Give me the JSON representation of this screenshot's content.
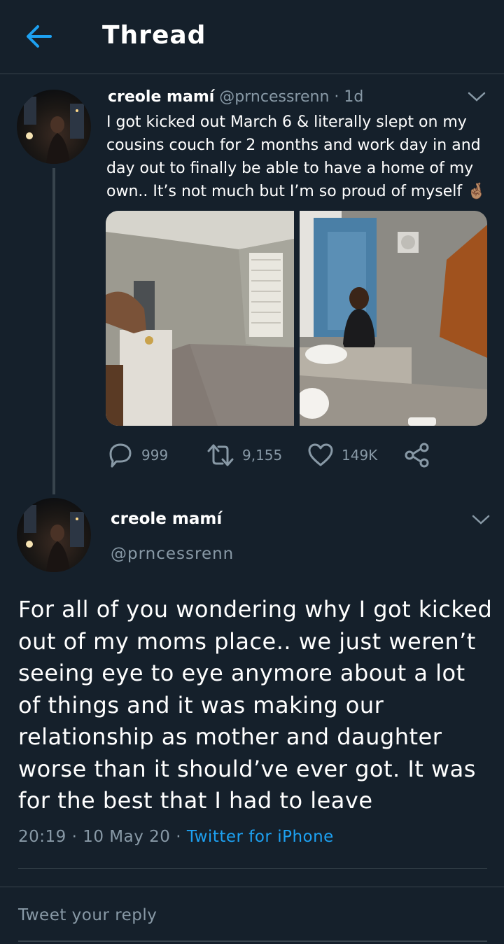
{
  "header": {
    "title": "Thread",
    "back_icon": "arrow-left-icon",
    "accent": "#1da1f2"
  },
  "tweet1": {
    "name": "creole mamí",
    "handle": "@prncessrenn",
    "time": "· 1d",
    "text": "I got kicked out March 6 & literally slept on my cousins couch for 2 months and work day in and day out to finally be able to have a home of my own.. It’s not much but I’m so proud of myself 🤞🏽",
    "media": [
      "empty-apartment-photo",
      "bathroom-mirror-selfie-photo"
    ],
    "actions": {
      "replies": "999",
      "retweets": "9,155",
      "likes": "149K"
    }
  },
  "tweet2": {
    "name": "creole mamí",
    "handle": "@prncessrenn",
    "text": "For all of you wondering why I got kicked out of my moms place.. we just weren’t seeing eye to eye anymore about a lot of things and it was making our relationship as mother and daughter worse than it should’ve ever got. It was for the best that I had to leave",
    "timestamp": "20:19 · 10 May 20 · ",
    "source": "Twitter for iPhone"
  },
  "reply": {
    "placeholder": "Tweet your reply"
  },
  "colors": {
    "background": "#15202b",
    "border": "#38444d",
    "secondary_text": "#8899a6",
    "link": "#1da1f2"
  }
}
